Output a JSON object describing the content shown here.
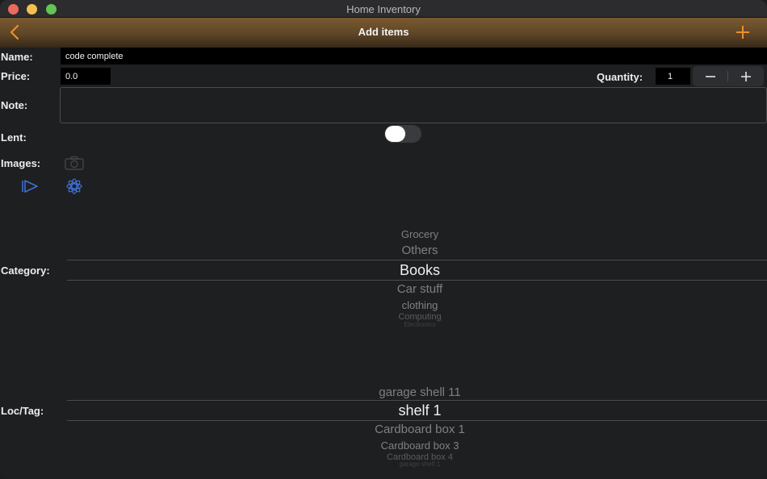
{
  "window": {
    "title": "Home Inventory"
  },
  "nav": {
    "title": "Add items"
  },
  "form": {
    "name_label": "Name:",
    "name_value": "code complete",
    "price_label": "Price:",
    "price_value": "0.0",
    "quantity_label": "Quantity:",
    "quantity_value": "1",
    "note_label": "Note:",
    "note_value": "",
    "lent_label": "Lent:",
    "lent_on": false,
    "images_label": "Images:"
  },
  "category": {
    "label": "Category:",
    "options": [
      "Grocery",
      "Others",
      "Books",
      "Car stuff",
      "clothing",
      "Computing",
      "Electronics"
    ],
    "selected": "Books"
  },
  "location": {
    "label": "Loc/Tag:",
    "options": [
      "garage shell 11",
      "shelf 1",
      "Cardboard box 1",
      "Cardboard box 3",
      "Cardboard box 4",
      "garage shelf 1"
    ],
    "selected": "shelf 1"
  },
  "icons": {
    "back": "chevron-left-icon",
    "add": "plus-icon",
    "minus": "minus-icon",
    "plus": "plus-icon",
    "camera": "camera-icon",
    "play": "play-icon",
    "photos": "flower-icon"
  },
  "colors": {
    "accent": "#e8912e",
    "link_blue": "#3d6fd6"
  }
}
